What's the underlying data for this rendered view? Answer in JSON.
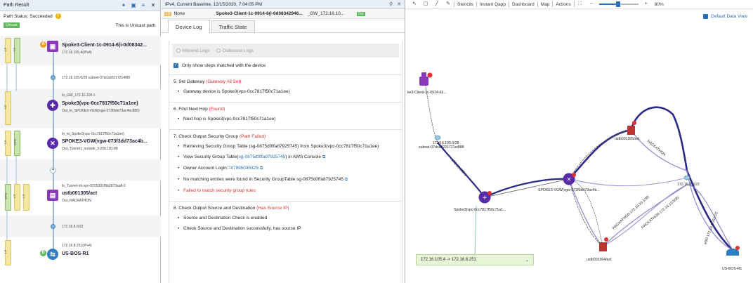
{
  "left_panel": {
    "title": "Path Result",
    "status_label": "Path Status:",
    "status_value": "Succeeded",
    "badge": "Unicast",
    "badge_text": "This is Unicast path.",
    "lanes": [
      "L3",
      "L3",
      "L3",
      "VPN",
      "L3",
      "VPN",
      "L3",
      "L3"
    ],
    "hops": [
      {
        "name": "Spoke3-Client-1c-0914-6(i-0d08342...",
        "sub1": "172.16.105.4(IPv4)",
        "badge": "A"
      },
      {
        "link": "172.16.105.0/28 subnet-07dca92217214f88"
      },
      {
        "in": "In_GW_172.16.105.1",
        "name": "Spoke3(vpc-0cc7817f50c71a1ee)",
        "out": "Out_to_SPOKE3-VGW(vgw-073f3dd73ac4bc880)"
      },
      {
        "in": "In_to_Spoke3(vpc-0cc7817f50c71a1ee)",
        "name": "SPOKE3-VGW(vgw-073f3dd73ac4b...",
        "out": "Out_Tunnel1_outside_3.208.183.88"
      },
      {
        "marker": "4"
      },
      {
        "in": "In_Tunnel-int-vpn-0225301f8b2873aa8-0",
        "name": "ustb001305/act",
        "out": "Out_HACKATHON"
      },
      {
        "link": "172.16.8.0/22"
      },
      {
        "sub1": "172.16.8.251(IPv4)",
        "name": "US-BOS-R1",
        "badge": "B"
      }
    ]
  },
  "middle_panel": {
    "title": "IPv4, Current Baseline, 12/15/2020, 7:04:05 PM",
    "sub_label": "L3",
    "sub_none": "None",
    "sub_node": "Spoke3-Client-1c-0914-6(i-0d08342946...",
    "sub_gw": "_GW_172.16.10...",
    "sub_ok": "Out",
    "tabs": [
      "Device Log",
      "Traffic State"
    ],
    "radio_in": "Inbound Logs",
    "radio_out": "Outbound Logs",
    "checkbox_label": "Only show steps matched with the device",
    "steps": [
      {
        "title": "5. Set Gateway ",
        "tag": "(Gateway All Set)",
        "items": [
          {
            "text": "Gateway device is Spoke3(vpc-0cc7817f50c71a1ee)"
          }
        ]
      },
      {
        "title": "6. Find Next Hop ",
        "tag": "(Found)",
        "items": [
          {
            "text": "Next hop is Spoke3(vpc-0cc7817f50c71a1ee)"
          }
        ]
      },
      {
        "title": "7. Check Output Security Group ",
        "tag": "(Path Failed)",
        "items": [
          {
            "text": "Retrieving Security Group Table (sg-0875d0ffa87925745) from Spoke3(vpc-0cc7817f50c71a1ee)"
          },
          {
            "pre": "View Security Group Table(",
            "link": "sg-0875d0ffa87925745",
            "post": ") in AWS Console"
          },
          {
            "pre": "Owner Account Login:",
            "link": "747895045325"
          },
          {
            "text": "No matching entries were found in Security GroupTable sg-0875d0ffa87925745"
          },
          {
            "text": "Failed to match security group rules",
            "error": true
          }
        ]
      },
      {
        "title": "8. Check Output Source and Destination ",
        "tag": "(Has Source IP)",
        "items": [
          {
            "text": "Source and Destination Check is enabled"
          },
          {
            "text": "Check Source and Destination successfully, has source IP"
          }
        ]
      }
    ]
  },
  "map": {
    "toolbar": [
      "Stencils",
      "Instant Qapp",
      "Dashboard",
      "Map",
      "Actions"
    ],
    "zoom": "80%",
    "zoom_level": 0.8,
    "default_data_view": "Default Data View",
    "path_box": "172.16.105.4 -> 172.16.8.251",
    "labels": {
      "client": "ke3-Client-1c-0914-6(i...",
      "subnet1_a": "172.16.105.0/28",
      "subnet1_b": "subnet-07dca9221721e4f88",
      "spoke3": "Spoke3(vpc-0cc7817f50c71a1...",
      "vgw": "SPOKE3-VGW(vgw-073f3dd73ac4b...",
      "router_top": "ustb001305/act",
      "router_bot": "ustb001304/act",
      "subnet8": "172.16.8.0/22",
      "bos": "US-BOS-R1",
      "hack1": "HACKATHON",
      "hack2": "HACKATHON 172.16.10.1/30",
      "hack3": "HACKATHON 172.16.10.5/30",
      "bos_link": "e0/0 172.16.8.251/22",
      "tunnel": "Tunnel1 3.208.183.88",
      "gw_link": "172.16.105.1"
    }
  },
  "colors": {
    "path": "#2b2a86",
    "path_light": "#8e8ad1",
    "accent": "#2a6fb8",
    "error": "#e03030"
  }
}
